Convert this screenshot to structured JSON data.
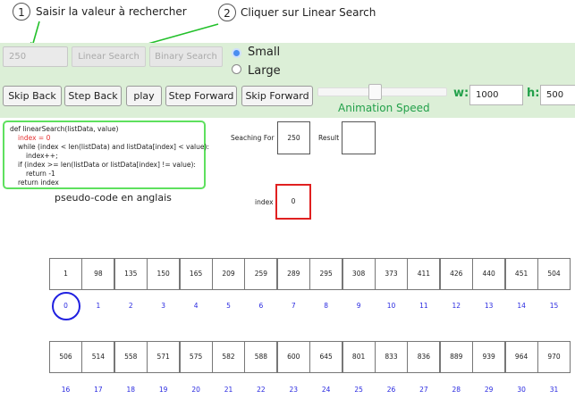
{
  "annotations": [
    {
      "number": "1",
      "text": "Saisir la valeur à rechercher"
    },
    {
      "number": "2",
      "text": "Cliquer sur Linear Search"
    }
  ],
  "controls": {
    "search_value": "250",
    "linear_search_label": "Linear Search",
    "binary_search_label": "Binary Search",
    "size_options": [
      {
        "label": "Small",
        "selected": true
      },
      {
        "label": "Large",
        "selected": false
      }
    ],
    "skip_back": "Skip Back",
    "step_back": "Step Back",
    "play": "play",
    "step_forward": "Step Forward",
    "skip_forward": "Skip Forward",
    "animation_speed_label": "Animation Speed",
    "animation_speed_level": 0.44,
    "w_label": "w:",
    "w_value": "1000",
    "h_label": "h:",
    "h_value": "500"
  },
  "code": {
    "lines": [
      {
        "text": "def linearSearch(listData, value)",
        "highlight": false
      },
      {
        "text": "index = 0",
        "highlight": true
      },
      {
        "text": "while (index < len(listData) and listData[index] < value):",
        "highlight": false
      },
      {
        "text": "index++;",
        "highlight": false
      },
      {
        "text": "if (index >= len(listData or listData[index] != value):",
        "highlight": false
      },
      {
        "text": "return -1",
        "highlight": false
      },
      {
        "text": "return index",
        "highlight": false
      }
    ],
    "caption": "pseudo-code en anglais"
  },
  "search": {
    "seeking_label": "Seaching For",
    "seeking_value": "250",
    "result_label": "Result",
    "result_value": "",
    "index_label": "index",
    "index_value": "0"
  },
  "array": {
    "row1_values": [
      "1",
      "98",
      "135",
      "150",
      "165",
      "209",
      "259",
      "289",
      "295",
      "308",
      "373",
      "411",
      "426",
      "440",
      "451",
      "504"
    ],
    "row1_indices": [
      "0",
      "1",
      "2",
      "3",
      "4",
      "5",
      "6",
      "7",
      "8",
      "9",
      "10",
      "11",
      "12",
      "13",
      "14",
      "15"
    ],
    "row2_values": [
      "506",
      "514",
      "558",
      "571",
      "575",
      "582",
      "588",
      "600",
      "645",
      "801",
      "833",
      "836",
      "889",
      "939",
      "964",
      "970"
    ],
    "row2_indices": [
      "16",
      "17",
      "18",
      "19",
      "20",
      "21",
      "22",
      "23",
      "24",
      "25",
      "26",
      "27",
      "28",
      "29",
      "30",
      "31"
    ],
    "current_index": 0
  },
  "colors": {
    "band": "#dcefd7",
    "accent_green": "#22a04a",
    "highlight_red": "#e53030",
    "index_blue": "#2a2ae0"
  }
}
